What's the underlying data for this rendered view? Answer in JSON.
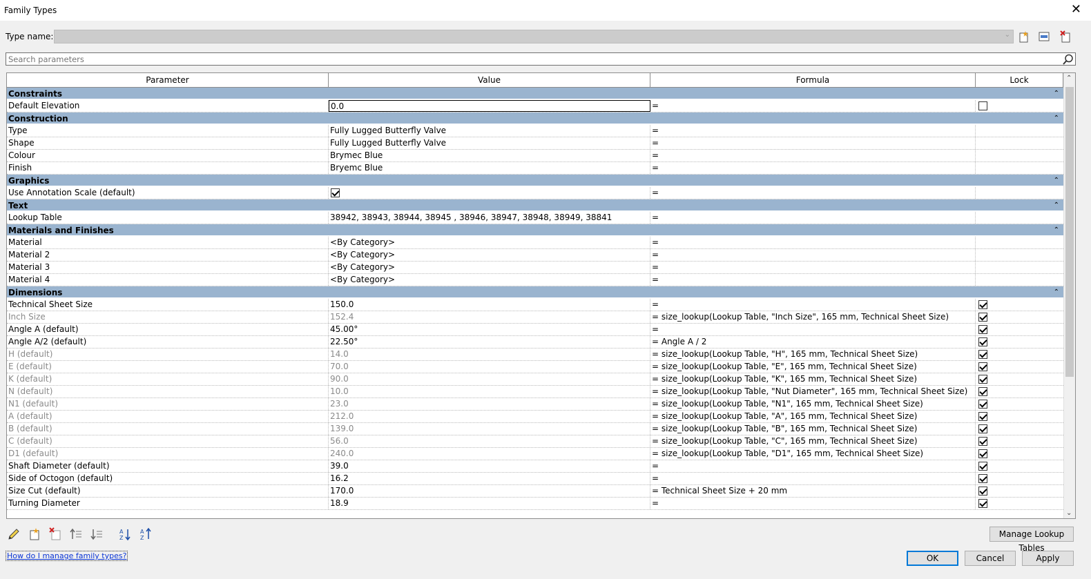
{
  "window": {
    "title": "Family Types",
    "close_symbol": "✕"
  },
  "type_name": {
    "label": "Type name:",
    "value": ""
  },
  "search": {
    "placeholder": "Search parameters"
  },
  "columns": {
    "parameter": "Parameter",
    "value": "Value",
    "formula": "Formula",
    "lock": "Lock"
  },
  "groups": {
    "constraints": "Constraints",
    "construction": "Construction",
    "graphics": "Graphics",
    "text": "Text",
    "materials": "Materials and Finishes",
    "dimensions": "Dimensions"
  },
  "rows": {
    "default_elevation": {
      "name": "Default Elevation",
      "value": "0.0",
      "formula": "="
    },
    "type": {
      "name": "Type",
      "value": "Fully Lugged Butterfly Valve",
      "formula": "="
    },
    "shape": {
      "name": "Shape",
      "value": "Fully Lugged Butterfly Valve",
      "formula": "="
    },
    "colour": {
      "name": "Colour",
      "value": "Brymec Blue",
      "formula": "="
    },
    "finish": {
      "name": "Finish",
      "value": "Bryemc Blue",
      "formula": "="
    },
    "use_annotation_scale": {
      "name": "Use Annotation Scale (default)",
      "checked": true,
      "formula": "="
    },
    "lookup_table": {
      "name": "Lookup Table",
      "value": "38942, 38943, 38944, 38945 , 38946, 38947, 38948, 38949, 38841",
      "formula": "="
    },
    "material": {
      "name": "Material",
      "value": "<By Category>",
      "formula": "="
    },
    "material2": {
      "name": "Material 2",
      "value": "<By Category>",
      "formula": "="
    },
    "material3": {
      "name": "Material 3",
      "value": "<By Category>",
      "formula": "="
    },
    "material4": {
      "name": "Material 4",
      "value": "<By Category>",
      "formula": "="
    },
    "technical_sheet_size": {
      "name": "Technical Sheet Size",
      "value": "150.0",
      "formula": "="
    },
    "inch_size": {
      "name": "Inch Size",
      "value": "152.4",
      "formula": "= size_lookup(Lookup Table, \"Inch Size\", 165 mm, Technical Sheet Size)"
    },
    "angle_a": {
      "name": "Angle A (default)",
      "value": "45.00°",
      "formula": "="
    },
    "angle_a2": {
      "name": "Angle A/2 (default)",
      "value": "22.50°",
      "formula": "= Angle A / 2"
    },
    "h": {
      "name": "H (default)",
      "value": "14.0",
      "formula": "= size_lookup(Lookup Table, \"H\", 165 mm, Technical Sheet Size)"
    },
    "e": {
      "name": "E (default)",
      "value": "70.0",
      "formula": "= size_lookup(Lookup Table, \"E\", 165 mm, Technical Sheet Size)"
    },
    "k": {
      "name": "K (default)",
      "value": "90.0",
      "formula": "= size_lookup(Lookup Table, \"K\", 165 mm, Technical Sheet Size)"
    },
    "n": {
      "name": "N (default)",
      "value": "10.0",
      "formula": "= size_lookup(Lookup Table, \"Nut Diameter\", 165 mm, Technical Sheet Size)"
    },
    "n1": {
      "name": "N1 (default)",
      "value": "23.0",
      "formula": "= size_lookup(Lookup Table, \"N1\", 165 mm, Technical Sheet Size)"
    },
    "a": {
      "name": "A (default)",
      "value": "212.0",
      "formula": "= size_lookup(Lookup Table, \"A\", 165 mm, Technical Sheet Size)"
    },
    "b": {
      "name": "B (default)",
      "value": "139.0",
      "formula": "= size_lookup(Lookup Table, \"B\", 165 mm, Technical Sheet Size)"
    },
    "c": {
      "name": "C (default)",
      "value": "56.0",
      "formula": "= size_lookup(Lookup Table, \"C\", 165 mm, Technical Sheet Size)"
    },
    "d1": {
      "name": "D1 (default)",
      "value": "240.0",
      "formula": "= size_lookup(Lookup Table, \"D1\", 165 mm, Technical Sheet Size)"
    },
    "shaft_diameter": {
      "name": "Shaft Diameter (default)",
      "value": "39.0",
      "formula": "="
    },
    "side_of_octogon": {
      "name": "Side of Octogon (default)",
      "value": "16.2",
      "formula": "="
    },
    "size_cut": {
      "name": "Size Cut (default)",
      "value": "170.0",
      "formula": "= Technical Sheet Size + 20 mm"
    },
    "turning_diameter": {
      "name": "Turning Diameter",
      "value": "18.9",
      "formula": "="
    }
  },
  "buttons": {
    "manage_lookup": "Manage Lookup Tables",
    "ok": "OK",
    "cancel": "Cancel",
    "apply": "Apply"
  },
  "help_link": "How do I manage family types?",
  "icons": {
    "new_type": "new-type-icon",
    "rename_type": "rename-type-icon",
    "delete_type": "delete-type-icon",
    "edit_param": "pencil-icon",
    "new_param": "new-parameter-icon",
    "delete_param": "delete-parameter-icon",
    "move_up": "move-up-icon",
    "move_down": "move-down-icon",
    "sort_asc": "sort-ascending-icon",
    "sort_desc": "sort-descending-icon"
  }
}
